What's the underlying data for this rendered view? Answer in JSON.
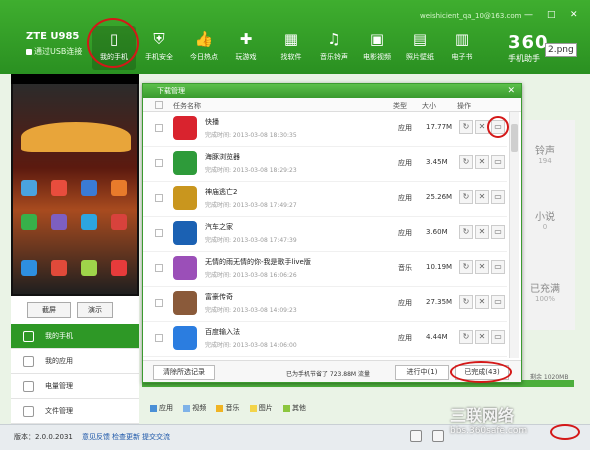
{
  "device": {
    "title": "ZTE U985",
    "connection": "通过USB连接"
  },
  "account": "weishicient_qa_10@163.com",
  "window_controls": [
    "—",
    "□",
    "✕"
  ],
  "toolbar": [
    {
      "label": "我的手机",
      "icon": "phone-icon",
      "glyph": "▯"
    },
    {
      "label": "手机安全",
      "icon": "shield-icon",
      "glyph": "⛨"
    },
    {
      "label": "今日热点",
      "icon": "thumb-icon",
      "glyph": "👍"
    },
    {
      "label": "玩游戏",
      "icon": "gamepad-icon",
      "glyph": "✚"
    },
    {
      "label": "找软件",
      "icon": "grid-icon",
      "glyph": "▦"
    },
    {
      "label": "音乐铃声",
      "icon": "music-icon",
      "glyph": "♫"
    },
    {
      "label": "电影视频",
      "icon": "film-icon",
      "glyph": "▣"
    },
    {
      "label": "照片壁纸",
      "icon": "picture-icon",
      "glyph": "▤"
    },
    {
      "label": "电子书",
      "icon": "book-icon",
      "glyph": "▥"
    }
  ],
  "brand": {
    "name": "360",
    "sub": "手机助手"
  },
  "tag": "2.png",
  "phone_buttons": {
    "screenshot": "截屏",
    "demo": "演示"
  },
  "left_nav": [
    {
      "label": "我的手机",
      "icon": "phone-icon"
    },
    {
      "label": "我的应用",
      "icon": "apps-icon"
    },
    {
      "label": "电量管理",
      "icon": "battery-icon"
    },
    {
      "label": "文件管理",
      "icon": "folder-icon"
    }
  ],
  "dialog": {
    "title": "下载管理",
    "headers": {
      "name": "任务名称",
      "type": "类型",
      "size": "大小",
      "action": "操作"
    },
    "rows": [
      {
        "name": "快播",
        "time": "完成时间: 2013-03-08 18:30:35",
        "type": "应用",
        "size": "17.77M",
        "color": "#d9232e"
      },
      {
        "name": "海豚浏览器",
        "time": "完成时间: 2013-03-08 18:29:23",
        "type": "应用",
        "size": "3.45M",
        "color": "#2e9b3a"
      },
      {
        "name": "神庙逃亡2",
        "time": "完成时间: 2013-03-08 17:49:27",
        "type": "应用",
        "size": "25.26M",
        "color": "#c9961e"
      },
      {
        "name": "汽车之家",
        "time": "完成时间: 2013-03-08 17:47:39",
        "type": "应用",
        "size": "3.60M",
        "color": "#1b61b3"
      },
      {
        "name": "无情的雨无情的你-我是歌手live版",
        "time": "完成时间: 2013-03-08 16:06:26",
        "type": "音乐",
        "size": "10.19M",
        "color": "#9b4fb8"
      },
      {
        "name": "富豪传奇",
        "time": "完成时间: 2013-03-08 14:09:23",
        "type": "应用",
        "size": "27.35M",
        "color": "#8a5a3a"
      },
      {
        "name": "百度输入法",
        "time": "完成时间: 2013-03-08 14:06:00",
        "type": "应用",
        "size": "4.44M",
        "color": "#2b7de0"
      }
    ],
    "footer": {
      "clear": "清除所选记录",
      "saved": "已为手机节省了 723.88M 流量",
      "in_progress": "进行中(1)",
      "done": "已完成(43)"
    }
  },
  "right_stats": [
    {
      "title": "铃声",
      "value": "194"
    },
    {
      "title": "小说",
      "value": "0"
    },
    {
      "title": "已充满",
      "value": "100%"
    }
  ],
  "free_space": "剩余 1020MB",
  "legend": [
    {
      "label": "应用",
      "color": "#4a8fd6"
    },
    {
      "label": "视频",
      "color": "#7fb2e8"
    },
    {
      "label": "音乐",
      "color": "#f0b424"
    },
    {
      "label": "图片",
      "color": "#f3d44a"
    },
    {
      "label": "其他",
      "color": "#8cc63f"
    }
  ],
  "status": {
    "version": "版本：2.0.0.2031",
    "feedback": "意见反馈",
    "update": "检查更新",
    "suggest": "提交交流"
  },
  "watermark": {
    "main": "三联网络",
    "sub": "bbs.360safe.com"
  }
}
